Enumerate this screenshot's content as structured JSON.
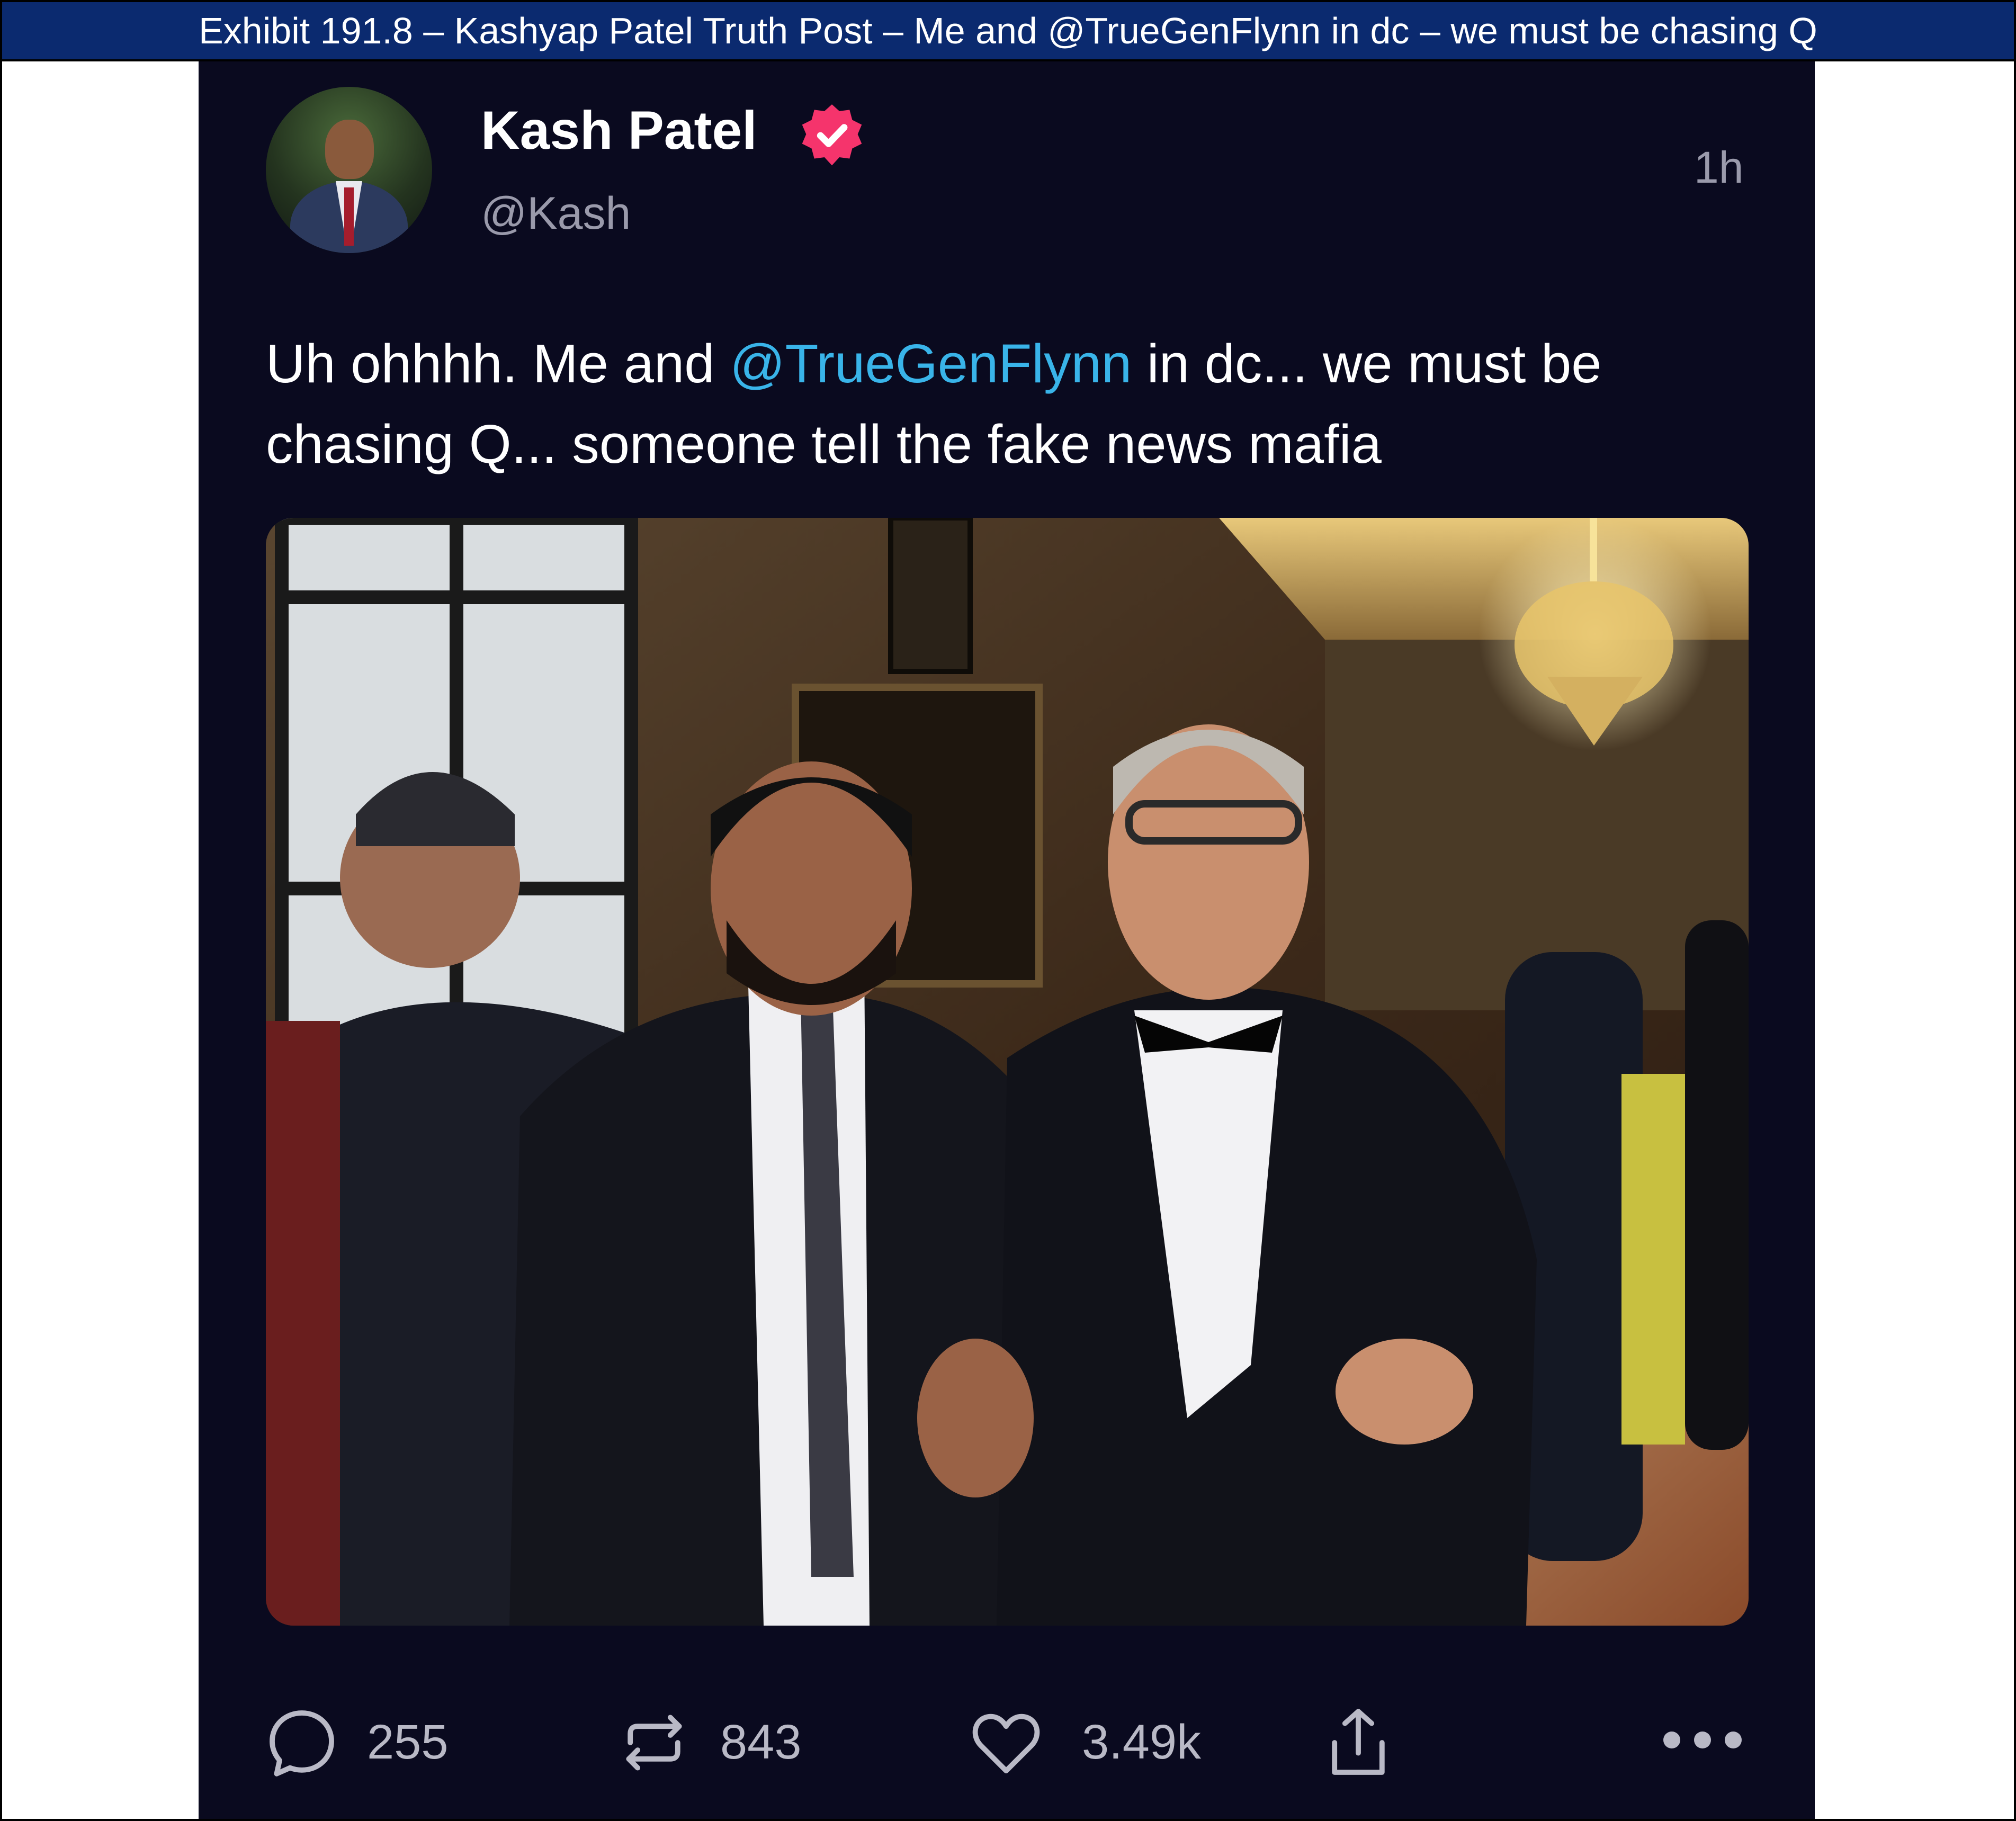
{
  "exhibit": {
    "caption": "Exhibit 191.8 – Kashyap Patel Truth Post – Me and @TrueGenFlynn in dc – we must be chasing Q"
  },
  "post": {
    "author_name": "Kash Patel",
    "handle": "@Kash",
    "timestamp": "1h",
    "verified_icon": "verified-badge-icon",
    "text_before": "Uh ohhhh. Me and ",
    "mention": "@TrueGenFlynn",
    "text_after": " in dc... we must be chasing Q... someone tell the fake news mafia",
    "photo_icon": "photo",
    "avatar_icon": "avatar"
  },
  "actions": {
    "replies": {
      "icon": "reply-icon",
      "count": "255"
    },
    "retruths": {
      "icon": "retruth-icon",
      "count": "843"
    },
    "likes": {
      "icon": "heart-icon",
      "count": "3.49k"
    },
    "share": {
      "icon": "share-icon"
    },
    "more": {
      "icon": "more-icon"
    }
  },
  "colors": {
    "exhibit_bar": "#0b2a6f",
    "post_background": "#0a0a1f",
    "mention": "#39b4e9",
    "verified_badge": "#f5346c",
    "secondary_text": "#9a9aab"
  }
}
